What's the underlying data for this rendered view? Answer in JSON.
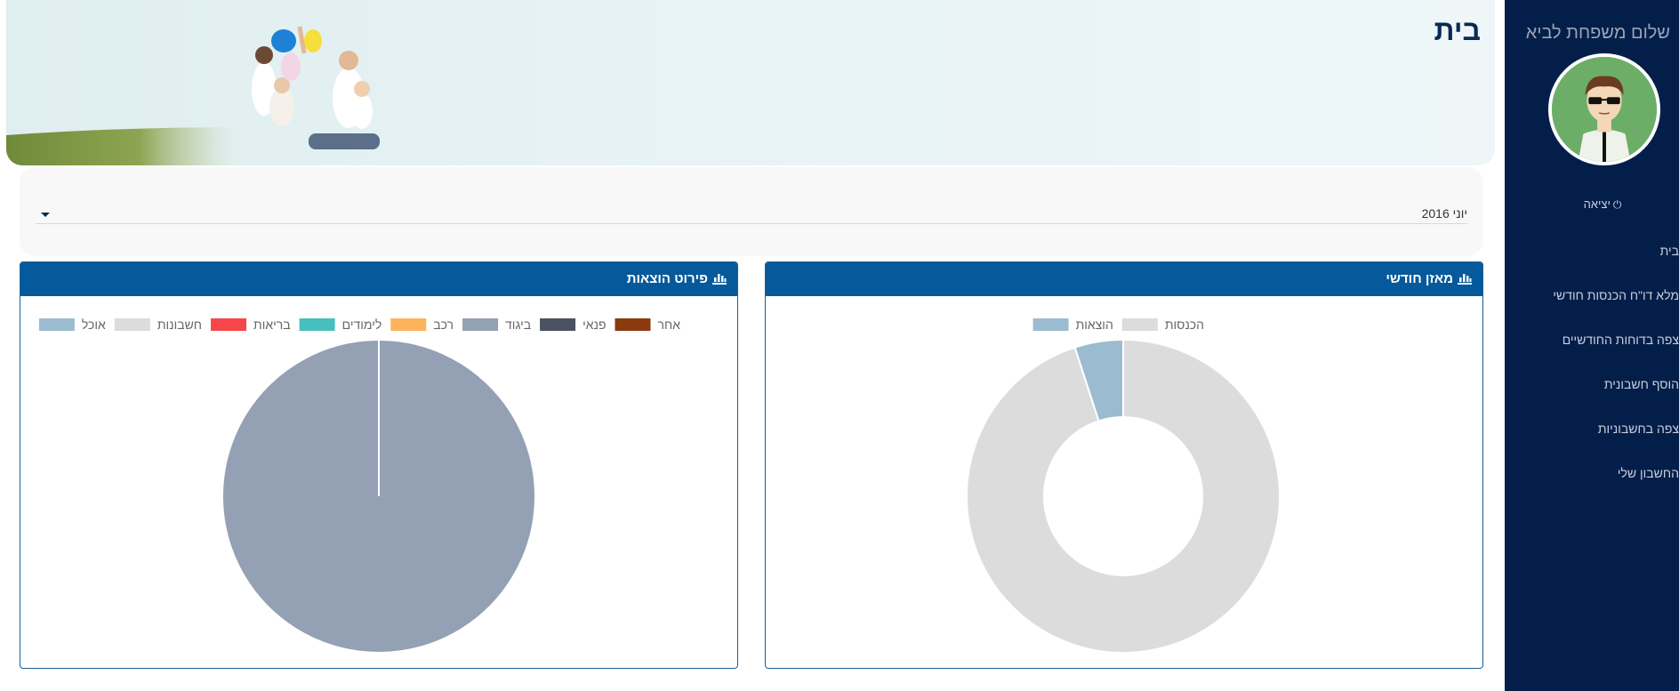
{
  "user": {
    "greeting": "שלום משפחת לביא"
  },
  "sidebar": {
    "logout_label": "יציאה",
    "items": [
      {
        "label": "בית"
      },
      {
        "label": "מלא דו\"ח הכנסות חודשי"
      },
      {
        "label": "צפה בדוחות החודשיים"
      },
      {
        "label": "הוסף חשבונית"
      },
      {
        "label": "צפה בחשבוניות"
      },
      {
        "label": "החשבון שלי"
      }
    ]
  },
  "page": {
    "title": "בית"
  },
  "filter": {
    "month_value": "יוני 2016"
  },
  "panels": {
    "balance": {
      "title": "מאזן חודשי",
      "icon": "bar-chart-icon"
    },
    "expenses": {
      "title": "פירוט הוצאות",
      "icon": "bar-chart-icon"
    }
  },
  "colors": {
    "sidebar_bg": "#041e4a",
    "panel_header": "#06599a",
    "title": "#0b2a52"
  },
  "chart_data": [
    {
      "type": "pie",
      "donut": true,
      "legend_position": "top",
      "labels": [
        "הכנסות",
        "הוצאות"
      ],
      "values": [
        95,
        5
      ],
      "colors": [
        "#dcdcdc",
        "#9bbcd0"
      ]
    },
    {
      "type": "pie",
      "legend_position": "top",
      "labels": [
        "אחר",
        "פנאי",
        "ביגוד",
        "רכב",
        "לימודים",
        "בריאות",
        "חשבונות",
        "אוכל"
      ],
      "values": [
        0,
        0,
        100,
        0,
        0,
        0,
        0,
        0
      ],
      "colors": [
        "#8b3a0f",
        "#4a5160",
        "#94a0b3",
        "#fdb35c",
        "#46bfbd",
        "#f7464a",
        "#dcdcdc",
        "#9bbcd0"
      ]
    }
  ]
}
